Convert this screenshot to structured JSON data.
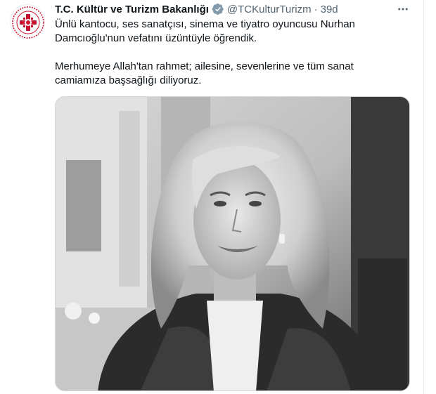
{
  "tweet": {
    "author_name": "T.C. Kültür ve Turizm Bakanlığı",
    "handle": "@TCKulturTurizm",
    "separator": "·",
    "time": "39d",
    "text_line1": "Ünlü kantocu, ses sanatçısı, sinema ve tiyatro oyuncusu Nurhan",
    "text_line2": "Damcıoğlu'nun vefatını üzüntüyle öğrendik.",
    "text_line3": "Merhumeye Allah'tan rahmet; ailesine, sevenlerine ve tüm sanat",
    "text_line4": "camiamıza başsağlığı diliyoruz.",
    "verified_icon": "verified-badge-icon",
    "more_icon": "more-options-icon"
  },
  "colors": {
    "accent": "#1d9bf0",
    "secondary_text": "#536471",
    "brand_red": "#c8102e"
  }
}
